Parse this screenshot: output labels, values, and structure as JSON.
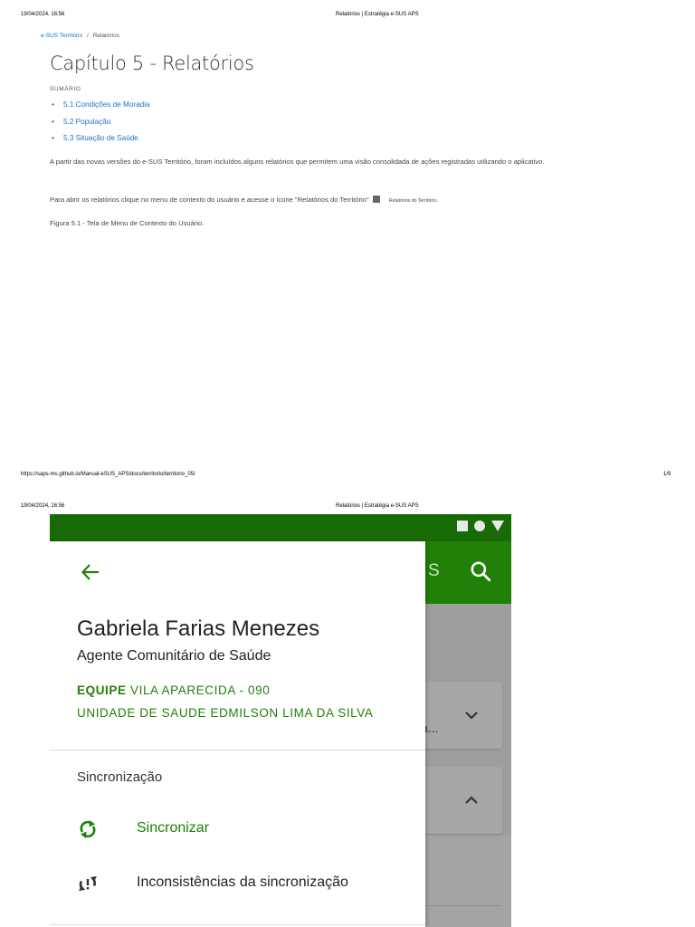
{
  "page": {
    "header_datetime": "19/04/2024, 16:56",
    "header_title": "Relatórios | Estratégia e-SUS APS",
    "footer_url": "https://saps-ms.github.io/Manual-eSUS_APS/docs/territorio/territorio_05/",
    "footer_page": "1/9"
  },
  "breadcrumb": {
    "root": "e-SUS Território",
    "separator": "/",
    "current": "Relatórios"
  },
  "content": {
    "title": "Capítulo 5 - Relatórios",
    "summary_label": "SUMÁRIO",
    "toc": [
      "5.1 Condições de Moradia",
      "5.2 População",
      "5.3 Situação de Saúde"
    ],
    "paragraph1": "A partir das novas versões do e-SUS Território, foram incluídos alguns relatórios que permitem uma visão consolidada de ações registradas utilizando o aplicativo.",
    "paragraph2": "Para abrir os relatórios clique no menu de contexto do usuário e acesse o ícone \"Relatórios do Território\"",
    "inline_icon_label": "Relatórios do Território",
    "paragraph2_end": ".",
    "figure_caption": "Figura 5.1 - Tela de Menu de Contexto do Usuário."
  },
  "app": {
    "colors": {
      "status_bar": "#176a05",
      "app_bar": "#208008",
      "accent": "#208008"
    },
    "appbar_partial_text": "S",
    "card_partial_text": "a...",
    "drawer": {
      "user_name": "Gabriela Farias Menezes",
      "user_role": "Agente Comunitário de Saúde",
      "team_label": "EQUIPE",
      "team_name": "VILA APARECIDA - 090",
      "unit_name": "UNIDADE DE SAUDE EDMILSON LIMA DA SILVA",
      "section_sync": "Sincronização",
      "item_sync": "Sincronizar",
      "item_sync_inconsistencies": "Inconsistências da sincronização"
    }
  }
}
